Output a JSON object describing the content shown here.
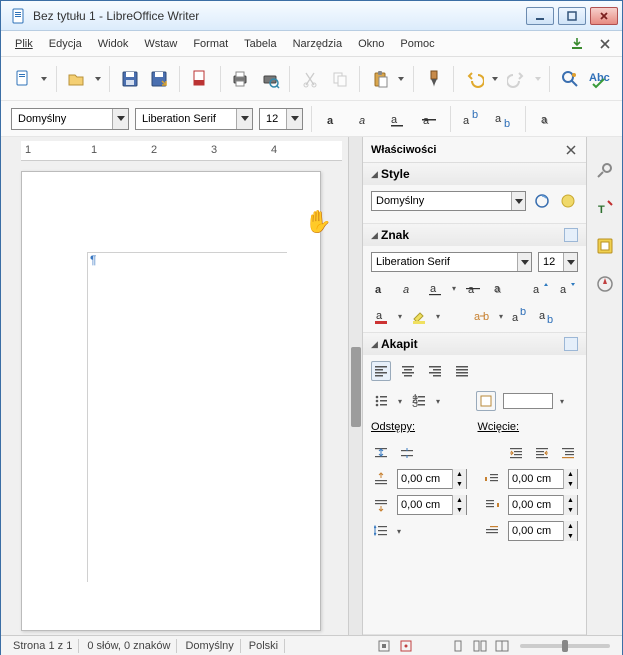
{
  "window": {
    "title": "Bez tytułu 1 - LibreOffice Writer"
  },
  "menu": {
    "items": [
      "Plik",
      "Edycja",
      "Widok",
      "Wstaw",
      "Format",
      "Tabela",
      "Narzędzia",
      "Okno",
      "Pomoc"
    ]
  },
  "toolbar": {
    "buttons": [
      "new-doc",
      "open",
      "save",
      "saveas",
      "export-pdf",
      "print",
      "print-preview",
      "cut",
      "copy",
      "paste",
      "format-paintbrush",
      "undo",
      "redo",
      "find-replace",
      "spellcheck"
    ]
  },
  "formatbar": {
    "para_style": "Domyślny",
    "font_name": "Liberation Serif",
    "font_size": "12"
  },
  "ruler": {
    "marks": [
      "1",
      "",
      "1",
      "2",
      "3",
      "4"
    ]
  },
  "document": {
    "pilcrow": "¶"
  },
  "side_panel": {
    "title": "Właściwości",
    "sections": {
      "style": {
        "title": "Style",
        "value": "Domyślny"
      },
      "char": {
        "title": "Znak",
        "font_name": "Liberation Serif",
        "font_size": "12"
      },
      "para": {
        "title": "Akapit",
        "spacing_label": "Odstępy:",
        "indent_label": "Wcięcie:",
        "spacing_above": "0,00 cm",
        "spacing_below": "0,00 cm",
        "indent_left": "0,00 cm",
        "indent_right": "0,00 cm",
        "indent_first": "0,00 cm"
      }
    }
  },
  "statusbar": {
    "page": "Strona 1 z 1",
    "words": "0 słów, 0 znaków",
    "style": "Domyślny",
    "lang": "Polski"
  }
}
